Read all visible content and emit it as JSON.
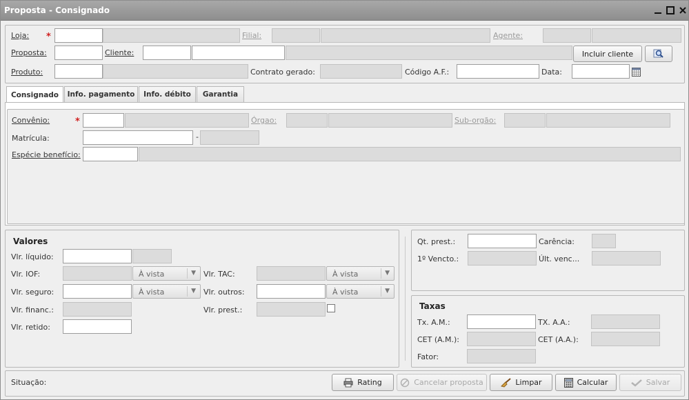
{
  "window": {
    "title": "Proposta - Consignado"
  },
  "header": {
    "loja_label": "Loja:",
    "filial_label": "Filial:",
    "agente_label": "Agente:",
    "proposta_label": "Proposta:",
    "cliente_label": "Cliente:",
    "incluir_cliente_label": "Incluir cliente",
    "produto_label": "Produto:",
    "contrato_label": "Contrato gerado:",
    "codigo_af_label": "Código A.F.:",
    "data_label": "Data:"
  },
  "tabs": [
    {
      "label": "Consignado"
    },
    {
      "label": "Info. pagamento"
    },
    {
      "label": "Info. débito"
    },
    {
      "label": "Garantia"
    }
  ],
  "consignado": {
    "convenio_label": "Convênio:",
    "orgao_label": "Órgao:",
    "suborgao_label": "Sub-orgão:",
    "matricula_label": "Matrícula:",
    "matricula_sep": "-",
    "especie_label": "Espécie benefício:"
  },
  "valores": {
    "title": "Valores",
    "liquido_label": "Vlr. líquido:",
    "iof_label": "Vlr. IOF:",
    "seguro_label": "Vlr. seguro:",
    "financ_label": "Vlr. financ.:",
    "retido_label": "Vlr. retido:",
    "tac_label": "Vlr. TAC:",
    "outros_label": "Vlr. outros:",
    "prest_label": "Vlr. prest.:",
    "avista": "À vista"
  },
  "prestacoes": {
    "qt_label": "Qt. prest.:",
    "carencia_label": "Carência:",
    "vencto_label": "1º Vencto.:",
    "ult_label": "Últ. venc..."
  },
  "taxas": {
    "title": "Taxas",
    "am_label": "Tx. A.M.:",
    "aa_label": "TX. A.A.:",
    "cet_am_label": "CET (A.M.):",
    "cet_aa_label": "CET (A.A.):",
    "fator_label": "Fator:"
  },
  "footer": {
    "situacao_label": "Situação:",
    "rating_label": "Rating",
    "cancelar_label": "Cancelar proposta",
    "limpar_label": "Limpar",
    "calcular_label": "Calcular",
    "salvar_label": "Salvar"
  },
  "colors": {
    "required": "#d02020",
    "titlebar": "#9a9a9a"
  }
}
